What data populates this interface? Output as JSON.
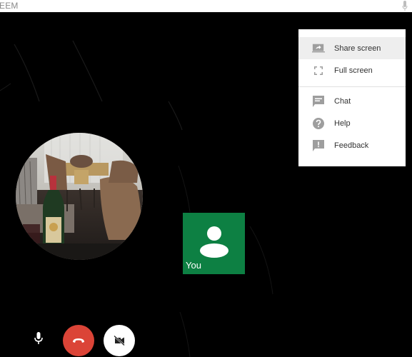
{
  "window": {
    "title": "EEM",
    "mic_indicator_icon": "microphone-icon"
  },
  "remote_participant": {
    "view": "video-circle",
    "scene": "restaurant interior with wine bottle and wicker chairs"
  },
  "self_view": {
    "label": "You",
    "avatar_icon": "person-icon",
    "tile_color": "#0d8043"
  },
  "menu": {
    "items": [
      {
        "label": "Share screen",
        "icon": "present-to-all-icon",
        "highlighted": true
      },
      {
        "label": "Full screen",
        "icon": "fullscreen-icon",
        "highlighted": false
      },
      {
        "label": "Chat",
        "icon": "chat-icon",
        "highlighted": false
      },
      {
        "label": "Help",
        "icon": "help-icon",
        "highlighted": false
      },
      {
        "label": "Feedback",
        "icon": "feedback-icon",
        "highlighted": false
      }
    ]
  },
  "controls": {
    "mic": {
      "icon": "microphone-icon",
      "state": "on"
    },
    "hangup": {
      "icon": "phone-hangup-icon",
      "color": "#db4437"
    },
    "camera": {
      "icon": "camera-off-icon",
      "state": "off"
    }
  },
  "colors": {
    "background": "#000000",
    "menu_icon": "#9e9e9e",
    "menu_text": "#333333",
    "menu_highlight": "#eeeeee"
  }
}
